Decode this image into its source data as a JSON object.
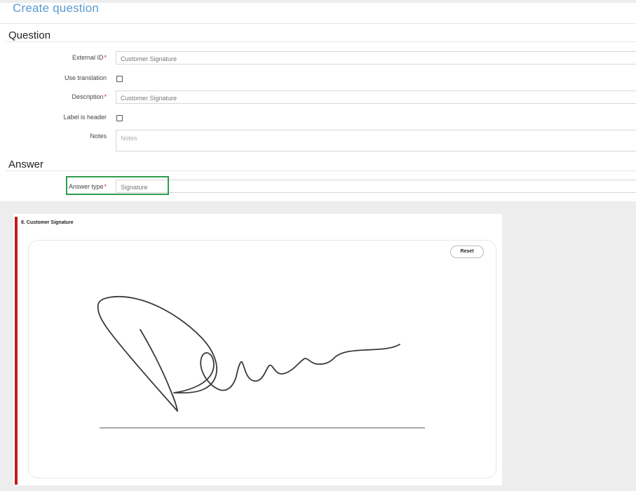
{
  "header": {
    "title": "Create question"
  },
  "question_section": {
    "title": "Question",
    "external_id": {
      "label": "External ID",
      "required_mark": "*",
      "value": "Customer Signature"
    },
    "use_translation": {
      "label": "Use translation",
      "checked": false
    },
    "description": {
      "label": "Description",
      "required_mark": "*",
      "value": "Customer Signature"
    },
    "label_is_header": {
      "label": "Label is header",
      "checked": false
    },
    "notes": {
      "label": "Notes",
      "value": "",
      "placeholder": "Notes"
    }
  },
  "answer_section": {
    "title": "Answer",
    "answer_type": {
      "label": "Answer type",
      "required_mark": "*",
      "value": "Signature"
    },
    "highlight_color": "#2e9e4b"
  },
  "signature_preview": {
    "question_label": "8. Customer Signature",
    "reset_label": "Reset",
    "accent_color": "#c41a1a"
  }
}
